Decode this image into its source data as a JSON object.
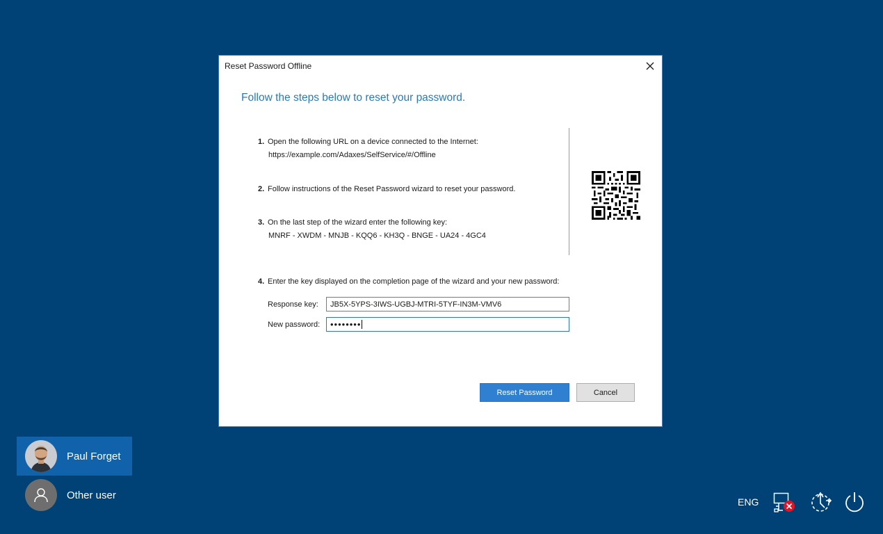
{
  "dialog": {
    "title": "Reset Password Offline",
    "headline": "Follow the steps below to reset your password.",
    "steps": [
      {
        "num": "1.",
        "text": "Open the following URL on a device connected to the Internet:",
        "sub": "https://example.com/Adaxes/SelfService/#/Offline"
      },
      {
        "num": "2.",
        "text": "Follow instructions of the Reset Password wizard to reset your password."
      },
      {
        "num": "3.",
        "text": "On the last step of the wizard enter the following key:",
        "sub": "MNRF - XWDM - MNJB - KQQ6 - KH3Q - BNGE - UA24 - 4GC4"
      },
      {
        "num": "4.",
        "text": "Enter the key displayed on the completion page of the wizard and your new password:"
      }
    ],
    "response_key": {
      "label": "Response key:",
      "value": "JB5X-5YPS-3IWS-UGBJ-MTRI-5TYF-IN3M-VMV6"
    },
    "new_password": {
      "label": "New password:",
      "value": "••••••••"
    },
    "buttons": {
      "reset": "Reset Password",
      "cancel": "Cancel"
    }
  },
  "users": [
    {
      "name": "Paul Forget",
      "selected": true
    },
    {
      "name": "Other user",
      "selected": false
    }
  ],
  "tray": {
    "language": "ENG",
    "icons": [
      "network-disconnected-icon",
      "ease-of-access-icon",
      "power-icon"
    ]
  },
  "colors": {
    "background": "#004275",
    "accent": "#2a7ab8",
    "primary_button": "#2f80d0",
    "selected_user": "#1062ab"
  }
}
